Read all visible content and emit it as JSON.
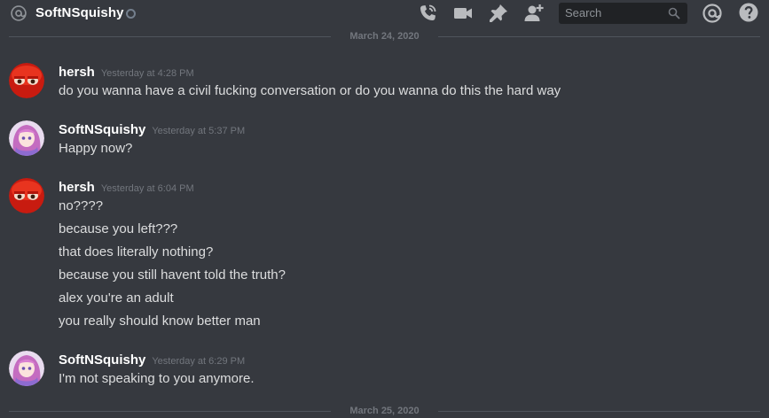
{
  "header": {
    "channel_name": "SoftNSquishy",
    "search_placeholder": "Search"
  },
  "dividers": [
    {
      "label": "March 24, 2020"
    },
    {
      "label": "March 25, 2020"
    }
  ],
  "messages": [
    {
      "author": "hersh",
      "timestamp": "Yesterday at 4:28 PM",
      "lines": [
        "do you wanna have a civil fucking conversation or do you wanna do this the hard way"
      ]
    },
    {
      "author": "SoftNSquishy",
      "timestamp": "Yesterday at 5:37 PM",
      "lines": [
        "Happy now?"
      ]
    },
    {
      "author": "hersh",
      "timestamp": "Yesterday at 6:04 PM",
      "lines": [
        "no????",
        "because you left???",
        "that does literally nothing?",
        "because you still havent told the truth?",
        "alex you're an adult",
        "you really should know better man"
      ]
    },
    {
      "author": "SoftNSquishy",
      "timestamp": "Yesterday at 6:29 PM",
      "lines": [
        "I'm not speaking to you anymore."
      ]
    }
  ],
  "colors": {
    "background": "#36393f",
    "author_name": "#ffffff",
    "timestamp": "#72767d",
    "message_text": "#dcddde"
  }
}
